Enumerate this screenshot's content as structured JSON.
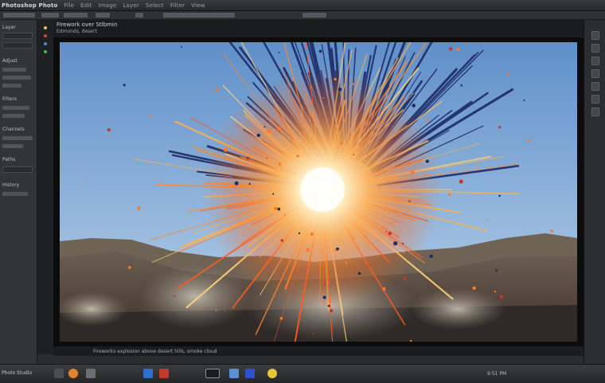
{
  "app": {
    "title": "Photoshop Photo",
    "menu": [
      "File",
      "Edit",
      "Image",
      "Layer",
      "Select",
      "Filter",
      "View"
    ]
  },
  "viewer": {
    "title": "Firework over Stlbmin",
    "subtitle": "Edmonds, desert"
  },
  "statusline": "Fireworks explosion above desert hills, smoke cloud",
  "left_panel": {
    "labels": [
      "Layer",
      "Adjust",
      "Filters",
      "Channels",
      "Paths",
      "History"
    ]
  },
  "taskbar": {
    "app_label": "Photo Studio",
    "tray_text": "9:51 PM"
  },
  "colors": {
    "sky_top": "#5f8fc9",
    "sky_bottom": "#b7d0e6",
    "firework_core": "#fff2c8",
    "firework_orange": "#ff8a2a",
    "firework_blue": "#1d2a66",
    "ground": "#5a4a3e"
  },
  "icons": [
    "folder-icon",
    "browser-icon",
    "file-icon",
    "window-icon",
    "ie-icon",
    "media-icon"
  ]
}
